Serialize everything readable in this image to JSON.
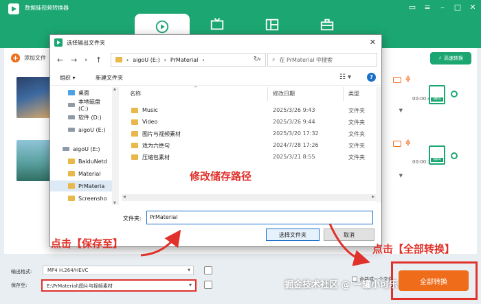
{
  "app": {
    "title": "数据蛙视频转换器",
    "add_file_label": "添加文件",
    "hw_accel_label": "高速转换",
    "rows": [
      {
        "duration": "00:00:41"
      },
      {
        "duration": "00:00:30"
      }
    ],
    "output_format_label": "输出格式:",
    "output_format_value": "MP4 H.264/HEVC",
    "save_to_label": "保存至:",
    "save_to_value": "E:\\PrMaterial\\图片与视频素材",
    "merge_label": "合并成一个文件",
    "convert_all_label": "全部转换"
  },
  "dialog": {
    "title": "选择输出文件夹",
    "address": {
      "drive": "aigoU (E:)",
      "folder": "PrMaterial"
    },
    "search_placeholder": "在 PrMaterial 中搜索",
    "toolbar": {
      "organize": "组织 ▾",
      "new_folder": "新建文件夹"
    },
    "tree": [
      "桌面",
      "本地磁盘 (C:)",
      "软件 (D:)",
      "aigoU (E:)",
      "aigoU (E:)",
      "BaiduNetd",
      "Material",
      "PrMateria",
      "Screensho"
    ],
    "columns": {
      "name": "名称",
      "modified": "修改日期",
      "type": "类型"
    },
    "files": [
      {
        "name": "Music",
        "date": "2025/3/26 9:43",
        "type": "文件夹"
      },
      {
        "name": "Video",
        "date": "2025/3/26 9:44",
        "type": "文件夹"
      },
      {
        "name": "图片与视频素材",
        "date": "2025/3/20 17:32",
        "type": "文件夹"
      },
      {
        "name": "戏为六绝句",
        "date": "2024/7/28 17:26",
        "type": "文件夹"
      },
      {
        "name": "压缩包素材",
        "date": "2025/3/21 8:55",
        "type": "文件夹"
      }
    ],
    "folder_label": "文件夹:",
    "folder_value": "PrMaterial",
    "select_button": "选择文件夹",
    "cancel_button": "取消"
  },
  "annotations": {
    "modify_path": "修改储存路径",
    "click_save": "点击【保存至】",
    "click_convert_all": "点击【全部转换】"
  },
  "watermark": "掘金技术社区 @ 一罐小可乐",
  "colors": {
    "brand_green": "#1ba672",
    "accent_orange": "#ef6c1a",
    "annotation_red": "#e0322b",
    "dialog_blue": "#1a6fc9"
  }
}
